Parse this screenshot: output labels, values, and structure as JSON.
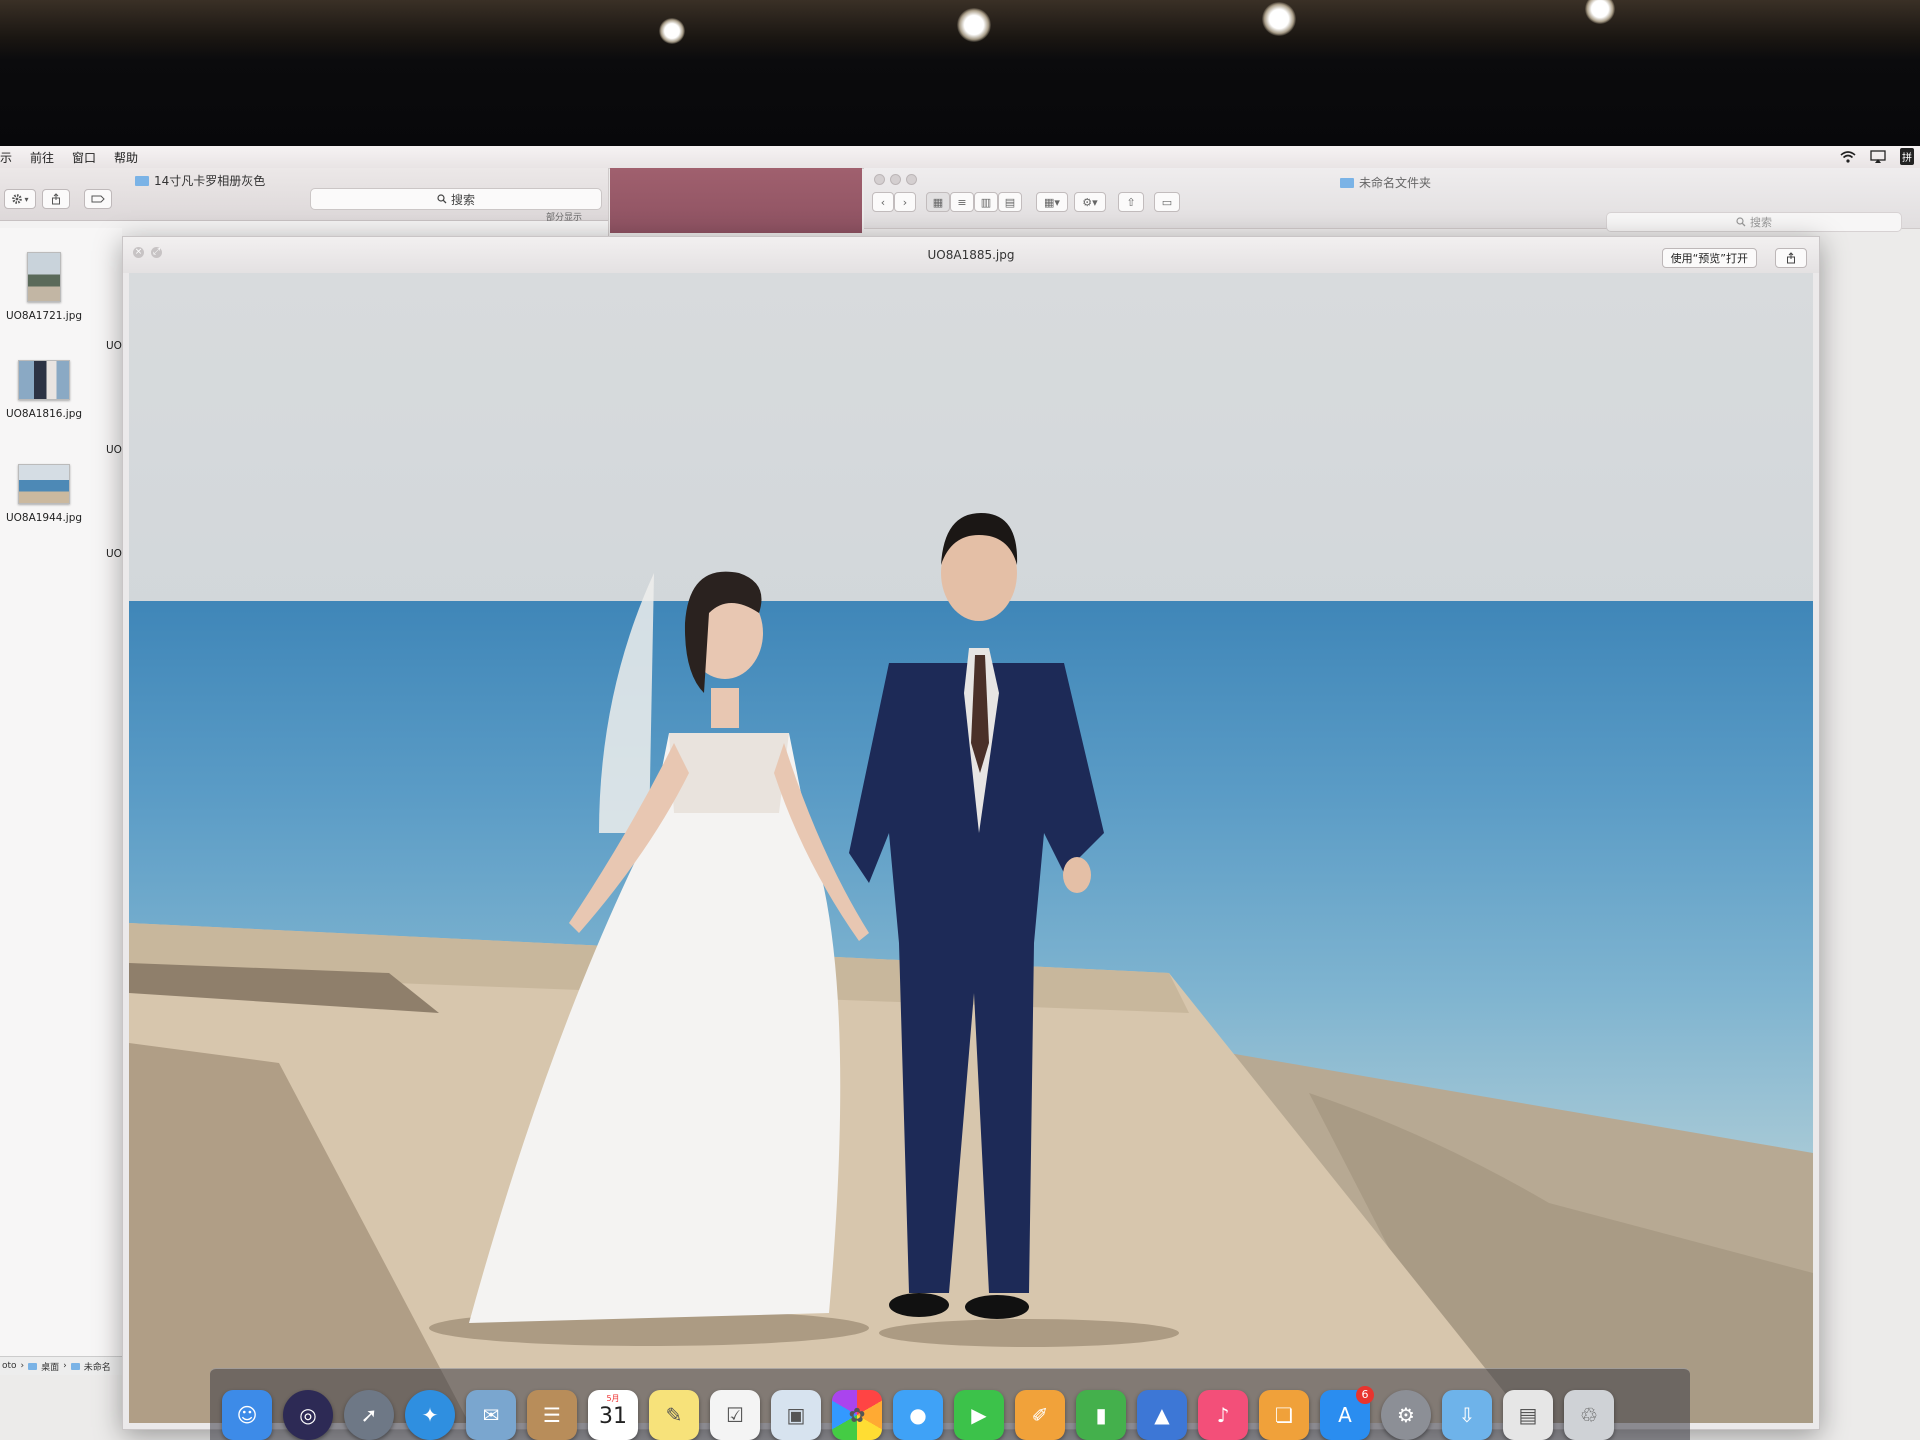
{
  "menubar": {
    "items": [
      "示",
      "前往",
      "窗口",
      "帮助"
    ],
    "input_method": "拼"
  },
  "finder_left": {
    "title": "14寸凡卡罗相册灰色",
    "search_placeholder": "搜索",
    "partial_label": "部分显示",
    "files": [
      {
        "name": "UO8A1721.jpg",
        "icon": "portrait-photo-thumbnail"
      },
      {
        "name": "UO8A1816.jpg",
        "icon": "couple-photo-thumbnail"
      },
      {
        "name": "UO8A1944.jpg",
        "icon": "seaside-photo-thumbnail"
      }
    ],
    "second_column_label": "UO",
    "path": [
      "oto",
      "桌面",
      "未命名"
    ]
  },
  "finder_right": {
    "title": "未命名文件夹",
    "search_placeholder": "搜索"
  },
  "quicklook": {
    "title": "UO8A1885.jpg",
    "open_with_label": "使用“预览”打开",
    "image_subject": "wedding-couple-seaside-photo"
  },
  "dock": {
    "apps": [
      {
        "name": "Finder",
        "icon": "finder-icon",
        "color": "#3d8be8"
      },
      {
        "name": "Siri",
        "icon": "siri-icon",
        "color": "#2d2a55"
      },
      {
        "name": "Launchpad",
        "icon": "launchpad-icon",
        "color": "#6e7886"
      },
      {
        "name": "Safari",
        "icon": "safari-icon",
        "color": "#2f8fe0"
      },
      {
        "name": "Mail",
        "icon": "mail-icon",
        "color": "#7aa6cf"
      },
      {
        "name": "Contacts",
        "icon": "contacts-icon",
        "color": "#b88d5a"
      },
      {
        "name": "Calendar",
        "icon": "calendar-icon",
        "color": "#ffffff",
        "month": "5月",
        "day": "31"
      },
      {
        "name": "Notes",
        "icon": "notes-icon",
        "color": "#f7e27a"
      },
      {
        "name": "Reminders",
        "icon": "reminders-icon",
        "color": "#f4f4f4"
      },
      {
        "name": "Preview",
        "icon": "preview-icon",
        "color": "#d7e3ef"
      },
      {
        "name": "Photos",
        "icon": "photos-icon",
        "color": "#f2f2f2"
      },
      {
        "name": "Messages",
        "icon": "messages-icon",
        "color": "#3fa2f7"
      },
      {
        "name": "FaceTime",
        "icon": "facetime-icon",
        "color": "#3cc24a"
      },
      {
        "name": "Pages",
        "icon": "pages-icon",
        "color": "#f1a23a"
      },
      {
        "name": "Numbers",
        "icon": "numbers-icon",
        "color": "#44b04c"
      },
      {
        "name": "Keynote",
        "icon": "keynote-icon",
        "color": "#3d77d6"
      },
      {
        "name": "iTunes",
        "icon": "itunes-icon",
        "color": "#f34f79"
      },
      {
        "name": "iBooks",
        "icon": "ibooks-icon",
        "color": "#f0a13a"
      },
      {
        "name": "App Store",
        "icon": "app-store-icon",
        "color": "#2a8df0",
        "badge": "6"
      },
      {
        "name": "System Preferences",
        "icon": "system-preferences-icon",
        "color": "#8c8f96"
      },
      {
        "name": "Downloads",
        "icon": "downloads-folder-icon",
        "color": "#6eb3ea"
      },
      {
        "name": "Documents",
        "icon": "documents-stack-icon",
        "color": "#e6e6e6"
      },
      {
        "name": "Trash",
        "icon": "trash-icon",
        "color": "#cfd2d6"
      }
    ]
  }
}
